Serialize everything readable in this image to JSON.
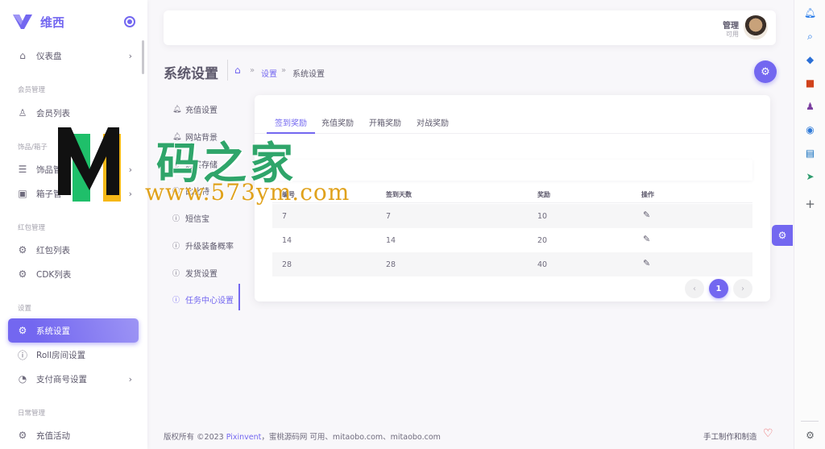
{
  "brand": {
    "name": "维西"
  },
  "sidebar": {
    "items": [
      {
        "label": "仪表盘",
        "icon": "home-icon"
      },
      {
        "header": "会员管理"
      },
      {
        "label": "会员列表",
        "icon": "user-icon"
      },
      {
        "header": "饰品/箱子"
      },
      {
        "label": "饰品管",
        "icon": "list-icon"
      },
      {
        "label": "箱子管",
        "icon": "box-icon"
      },
      {
        "header": "红包管理"
      },
      {
        "label": "红包列表",
        "icon": "gear-icon"
      },
      {
        "label": "CDK列表",
        "icon": "gear-icon"
      },
      {
        "header": "设置"
      },
      {
        "label": "系统设置",
        "icon": "gear-icon",
        "active": true
      },
      {
        "label": "Roll房间设置",
        "icon": "info-icon"
      },
      {
        "label": "支付商号设置",
        "icon": "pie-chart-icon"
      },
      {
        "header": "日常管理"
      },
      {
        "label": "充值活动",
        "icon": "gear-icon"
      }
    ]
  },
  "user": {
    "name": "管理",
    "role": "可用"
  },
  "page": {
    "title": "系统设置",
    "breadcrumb": {
      "link": "设置",
      "current": "系统设置",
      "separator": "»"
    }
  },
  "settings_menu": [
    {
      "label": "充值设置",
      "icon": "bell-icon"
    },
    {
      "label": "网站背景",
      "icon": "bell-icon"
    },
    {
      "label": "购买存储",
      "icon": "info-icon"
    },
    {
      "label": "比比特",
      "icon": "info-icon"
    },
    {
      "label": "短信宝",
      "icon": "info-icon"
    },
    {
      "label": "升级装备概率",
      "icon": "info-icon"
    },
    {
      "label": "发货设置",
      "icon": "info-icon"
    },
    {
      "label": "任务中心设置",
      "icon": "info-icon",
      "active": true
    }
  ],
  "tabs": [
    {
      "label": "签到奖励",
      "active": true
    },
    {
      "label": "充值奖励"
    },
    {
      "label": "开箱奖励"
    },
    {
      "label": "对战奖励"
    }
  ],
  "table": {
    "columns": [
      "编号",
      "签到天数",
      "奖励",
      "操作"
    ],
    "rows": [
      [
        "7",
        "7",
        "10"
      ],
      [
        "14",
        "14",
        "20"
      ],
      [
        "28",
        "28",
        "40"
      ]
    ]
  },
  "pagination": {
    "prev": "‹",
    "current": "1",
    "next": "›"
  },
  "footer": {
    "copyright_prefix": "版权所有 ©2023",
    "link": "Pixinvent",
    "copyright_suffix": "，蜜桃源码网 可用、mitaobo.com、mitaobo.com",
    "right": "手工制作和制造"
  },
  "watermark": {
    "title": "码之家",
    "url": "www.573ym.com"
  },
  "colors": {
    "primary": "#7367f0",
    "danger": "#ea5455",
    "watermark_green": "#2fa56a",
    "watermark_orange": "#e0a21c"
  }
}
